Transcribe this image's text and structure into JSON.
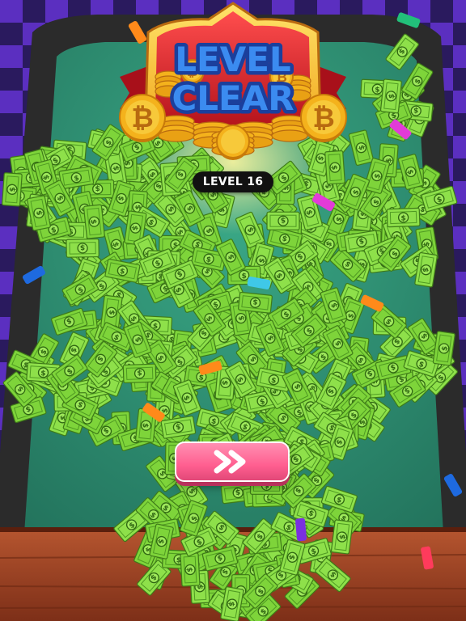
{
  "game": {
    "title": "LEVEL CLEAR",
    "title_line1": "LEVEL",
    "title_line2": "CLEAR",
    "level_label": "LEVEL 16"
  },
  "icons": {
    "coin": "bitcoin-coin-icon",
    "next": "double-chevron-right-icon",
    "bill": "dollar-bill-icon"
  },
  "colors": {
    "table_felt": "#2f8a70",
    "table_rim": "#2a2a2a",
    "checker_dark": "#2a1a5e",
    "checker_light": "#5b2fc0",
    "wood": "#a5482a",
    "cash": "#7ed43a",
    "next_button": "#ff6b98",
    "title_text": "#2f7de8",
    "coin": "#f4b21c"
  }
}
